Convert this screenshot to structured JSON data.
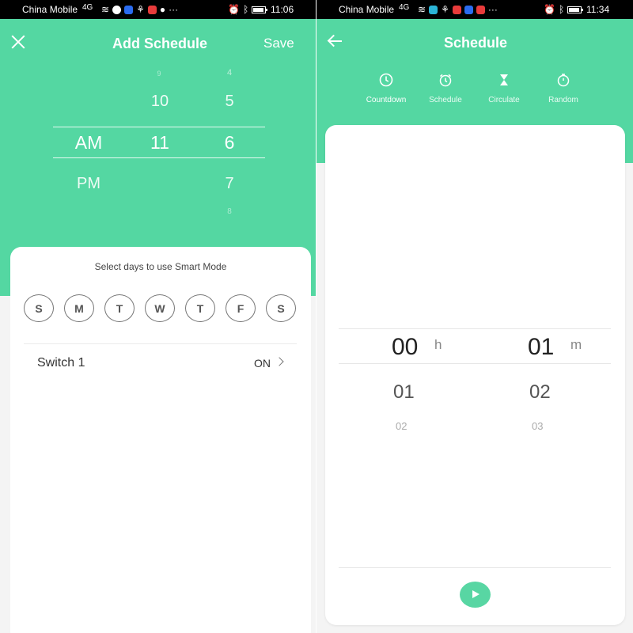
{
  "left": {
    "status": {
      "carrier": "China Mobile",
      "network": "4G",
      "time": "11:06"
    },
    "header": {
      "title": "Add Schedule",
      "save_label": "Save"
    },
    "picker": {
      "period_values": [
        "AM",
        "PM"
      ],
      "hour_values": [
        "9",
        "10",
        "11"
      ],
      "minute_values": [
        "4",
        "5",
        "6",
        "7",
        "8"
      ],
      "selected": {
        "period": "AM",
        "hour": "11",
        "minute": "6"
      }
    },
    "smart_mode_caption": "Select days to use Smart Mode",
    "days": [
      "S",
      "M",
      "T",
      "W",
      "T",
      "F",
      "S"
    ],
    "switch": {
      "label": "Switch 1",
      "value": "ON"
    }
  },
  "right": {
    "status": {
      "carrier": "China Mobile",
      "network": "4G",
      "time": "11:34"
    },
    "header": {
      "title": "Schedule"
    },
    "tabs": [
      {
        "label": "Countdown",
        "icon": "clock-icon"
      },
      {
        "label": "Schedule",
        "icon": "alarm-clock-icon"
      },
      {
        "label": "Circulate",
        "icon": "hourglass-icon"
      },
      {
        "label": "Random",
        "icon": "stopwatch-icon"
      }
    ],
    "countdown": {
      "hours": [
        "00",
        "01",
        "02"
      ],
      "minutes": [
        "01",
        "02",
        "03"
      ],
      "hour_unit": "h",
      "minute_unit": "m"
    }
  },
  "colors": {
    "accent": "#54d7a2",
    "status_bar": "#000000",
    "card": "#ffffff"
  }
}
